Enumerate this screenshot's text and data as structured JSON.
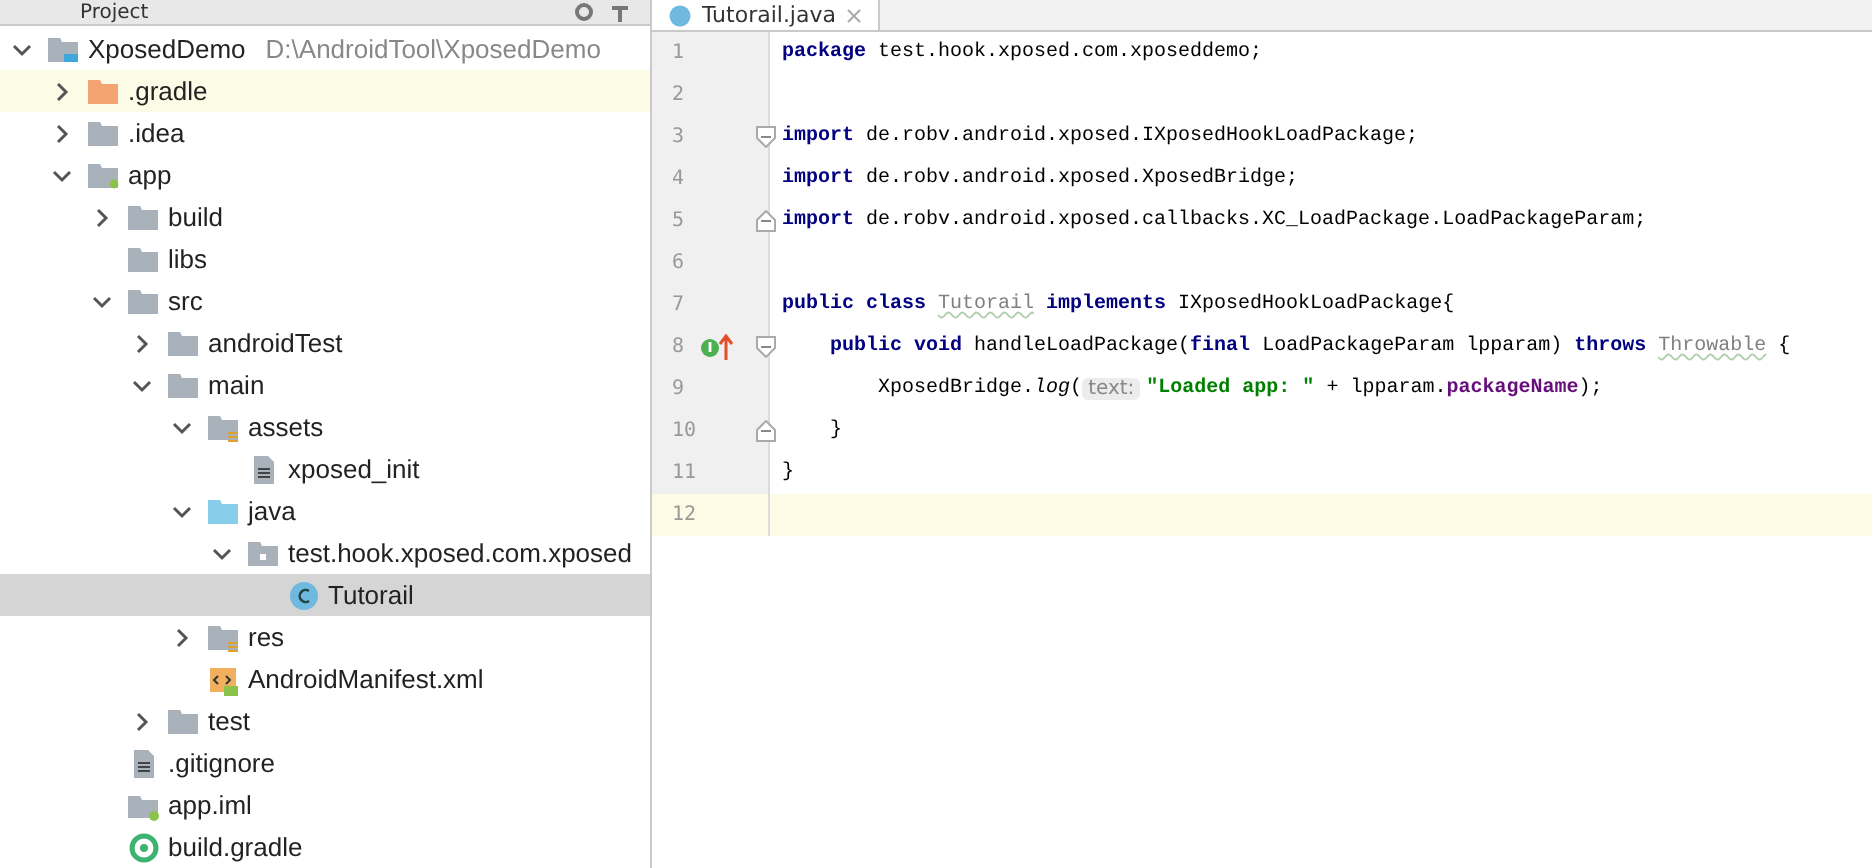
{
  "project_panel": {
    "title": "Project",
    "tree": [
      {
        "label": "XposedDemo",
        "path": "D:\\AndroidTool\\XposedDemo",
        "kind": "project",
        "expanded": true,
        "selected": false,
        "children": [
          {
            "label": ".gradle",
            "kind": "folder-excluded",
            "expanded": false,
            "selected": false,
            "highlighted": true
          },
          {
            "label": ".idea",
            "kind": "folder",
            "expanded": false,
            "selected": false
          },
          {
            "label": "app",
            "kind": "module",
            "expanded": true,
            "selected": false,
            "children": [
              {
                "label": "build",
                "kind": "folder",
                "expanded": false,
                "selected": false
              },
              {
                "label": "libs",
                "kind": "folder",
                "selected": false
              },
              {
                "label": "src",
                "kind": "folder",
                "expanded": true,
                "selected": false,
                "children": [
                  {
                    "label": "androidTest",
                    "kind": "folder",
                    "expanded": false,
                    "selected": false
                  },
                  {
                    "label": "main",
                    "kind": "folder",
                    "expanded": true,
                    "selected": false,
                    "children": [
                      {
                        "label": "assets",
                        "kind": "resource-folder",
                        "expanded": true,
                        "selected": false,
                        "children": [
                          {
                            "label": "xposed_init",
                            "kind": "file",
                            "selected": false
                          }
                        ]
                      },
                      {
                        "label": "java",
                        "kind": "source-folder",
                        "expanded": true,
                        "selected": false,
                        "children": [
                          {
                            "label": "test.hook.xposed.com.xposed",
                            "kind": "package",
                            "expanded": true,
                            "selected": false,
                            "children": [
                              {
                                "label": "Tutorail",
                                "kind": "class",
                                "selected": true
                              }
                            ]
                          }
                        ]
                      },
                      {
                        "label": "res",
                        "kind": "resource-folder",
                        "expanded": false,
                        "selected": false
                      },
                      {
                        "label": "AndroidManifest.xml",
                        "kind": "manifest",
                        "selected": false
                      }
                    ]
                  },
                  {
                    "label": "test",
                    "kind": "folder",
                    "expanded": false,
                    "selected": false
                  }
                ]
              },
              {
                "label": ".gitignore",
                "kind": "file",
                "selected": false
              },
              {
                "label": "app.iml",
                "kind": "module-file",
                "selected": false
              },
              {
                "label": "build.gradle",
                "kind": "gradle",
                "selected": false
              }
            ]
          }
        ]
      }
    ]
  },
  "editor": {
    "tabs": [
      {
        "label": "Tutorail.java",
        "selected": true
      }
    ],
    "lines": [
      {
        "number": "1",
        "current": false,
        "tokens": [
          {
            "kind": "kw",
            "text": "package"
          },
          {
            "kind": "plain",
            "text": " test.hook.xposed.com.xposeddemo;"
          }
        ]
      },
      {
        "number": "2",
        "current": false
      },
      {
        "number": "3",
        "current": false,
        "fold_start": true,
        "tokens": [
          {
            "kind": "kw",
            "text": "import"
          },
          {
            "kind": "plain",
            "text": " de.robv.android.xposed.IXposedHookLoadPackage;"
          }
        ]
      },
      {
        "number": "4",
        "current": false,
        "tokens": [
          {
            "kind": "kw",
            "text": "import"
          },
          {
            "kind": "plain",
            "text": " de.robv.android.xposed.XposedBridge;"
          }
        ]
      },
      {
        "number": "5",
        "current": false,
        "fold_end": true,
        "tokens": [
          {
            "kind": "kw",
            "text": "import"
          },
          {
            "kind": "plain",
            "text": " de.robv.android.xposed.callbacks.XC_LoadPackage.LoadPackageParam;"
          }
        ]
      },
      {
        "number": "6",
        "current": false
      },
      {
        "number": "7",
        "current": false,
        "tokens": [
          {
            "kind": "kw",
            "text": "public class "
          },
          {
            "kind": "unused",
            "text": "Tutorail"
          },
          {
            "kind": "kw",
            "text": " implements "
          },
          {
            "kind": "plain",
            "text": "IXposedHookLoadPackage{"
          }
        ]
      },
      {
        "number": "8",
        "current": false,
        "fold_start": true,
        "override": true,
        "tokens": [
          {
            "kind": "kw",
            "text": "    public void "
          },
          {
            "kind": "plain",
            "text": "handleLoadPackage("
          },
          {
            "kind": "kw",
            "text": "final "
          },
          {
            "kind": "plain",
            "text": "LoadPackageParam lpparam) "
          },
          {
            "kind": "kw",
            "text": "throws "
          },
          {
            "kind": "unused",
            "text": "Throwable"
          },
          {
            "kind": "plain",
            "text": " {"
          }
        ]
      },
      {
        "number": "9",
        "current": false,
        "tokens": [
          {
            "kind": "plain",
            "text": "        XposedBridge."
          },
          {
            "kind": "italic",
            "text": "log"
          },
          {
            "kind": "plain",
            "text": "("
          },
          {
            "kind": "hint",
            "text": "text:"
          },
          {
            "kind": "str",
            "text": "\"Loaded app: \""
          },
          {
            "kind": "plain",
            "text": " + lpparam."
          },
          {
            "kind": "field",
            "text": "packageName"
          },
          {
            "kind": "plain",
            "text": ");"
          }
        ]
      },
      {
        "number": "10",
        "current": false,
        "fold_end": true,
        "tokens": [
          {
            "kind": "plain",
            "text": "    }"
          }
        ]
      },
      {
        "number": "11",
        "current": false,
        "tokens": [
          {
            "kind": "plain",
            "text": "}"
          }
        ]
      },
      {
        "number": "12",
        "current": true
      }
    ]
  }
}
